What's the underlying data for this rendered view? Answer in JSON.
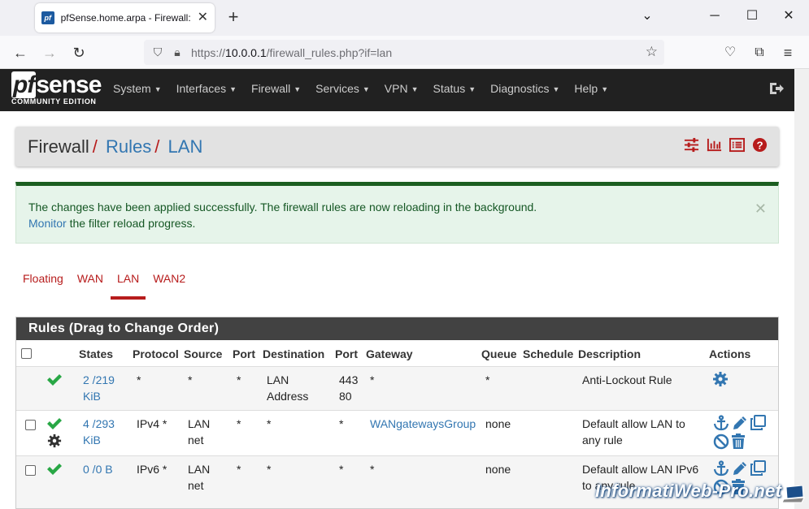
{
  "browser": {
    "tab_title": "pfSense.home.arpa - Firewall: R",
    "url_prefix": "https://",
    "url_host": "10.0.0.1",
    "url_path": "/firewall_rules.php?if=lan"
  },
  "header": {
    "logo_main_pf": "pf",
    "logo_main_rest": "sense",
    "logo_sub": "COMMUNITY EDITION",
    "menu": [
      "System",
      "Interfaces",
      "Firewall",
      "Services",
      "VPN",
      "Status",
      "Diagnostics",
      "Help"
    ]
  },
  "breadcrumb": {
    "root": "Firewall",
    "level2": "Rules",
    "level3": "LAN",
    "separator": "/"
  },
  "alert": {
    "line1": "The changes have been applied successfully. The firewall rules are now reloading in the background.",
    "link": "Monitor",
    "line2_rest": " the filter reload progress."
  },
  "tabs": [
    "Floating",
    "WAN",
    "LAN",
    "WAN2"
  ],
  "active_tab": "LAN",
  "rules": {
    "title": "Rules (Drag to Change Order)",
    "columns": [
      "States",
      "Protocol",
      "Source",
      "Port",
      "Destination",
      "Port",
      "Gateway",
      "Queue",
      "Schedule",
      "Description",
      "Actions"
    ],
    "rows": [
      {
        "states_a": "2 /219",
        "states_b": "KiB",
        "protocol": "*",
        "source_a": "*",
        "source_b": "",
        "src_port": "*",
        "dest_a": "LAN",
        "dest_b": "Address",
        "dst_port_a": "443",
        "dst_port_b": "80",
        "gateway": "*",
        "queue": "*",
        "schedule": "",
        "description_a": "Anti-Lockout Rule",
        "description_b": ""
      },
      {
        "states_a": "4 /293",
        "states_b": "KiB",
        "protocol": "IPv4 *",
        "source_a": "LAN",
        "source_b": "net",
        "src_port": "*",
        "dest_a": "*",
        "dest_b": "",
        "dst_port_a": "*",
        "dst_port_b": "",
        "gateway": "WANgatewaysGroup",
        "queue": "none",
        "schedule": "",
        "description_a": "Default allow LAN to",
        "description_b": "any rule"
      },
      {
        "states_a": "0 /0 B",
        "states_b": "",
        "protocol": "IPv6 *",
        "source_a": "LAN",
        "source_b": "net",
        "src_port": "*",
        "dest_a": "*",
        "dest_b": "",
        "dst_port_a": "*",
        "dst_port_b": "",
        "gateway": "*",
        "queue": "none",
        "schedule": "",
        "description_a": "Default allow LAN IPv6",
        "description_b": "to any rule"
      }
    ]
  },
  "watermark": "InformatiWeb-Pro.net",
  "colors": {
    "accent_red": "#b71c1c",
    "link_blue": "#3276b1",
    "success_green": "#1b5e20",
    "header_dark": "#212121"
  }
}
